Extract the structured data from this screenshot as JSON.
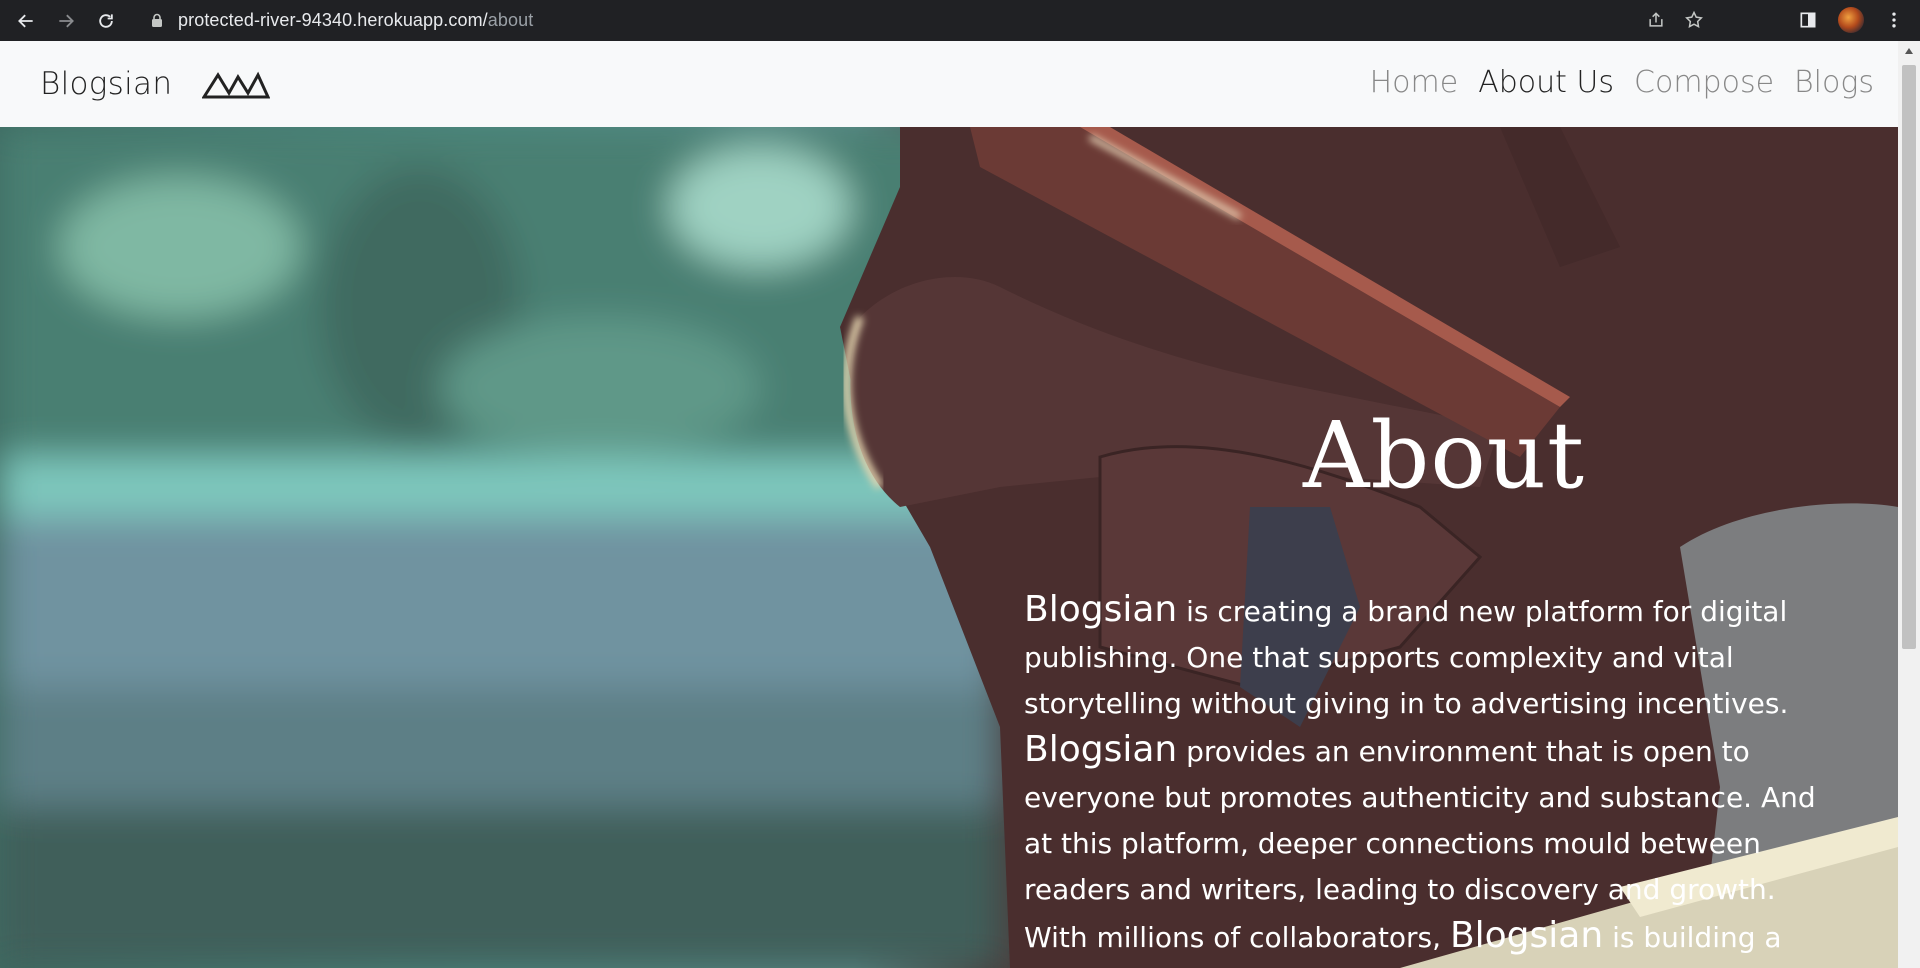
{
  "browser": {
    "url_host": "protected-river-94340.herokuapp.com/",
    "url_path": "about",
    "icons": [
      "back-icon",
      "forward-icon",
      "reload-icon",
      "lock-icon",
      "share-icon",
      "bookmark-star-icon",
      "side-panel-icon",
      "profile-avatar",
      "menu-dots-icon"
    ]
  },
  "navbar": {
    "brand": "Blogsian",
    "logo_icon": "mountains-icon",
    "links": [
      "Home",
      "About Us",
      "Compose",
      "Blogs"
    ],
    "active_link": "About Us"
  },
  "hero": {
    "title": "About",
    "brand_word": "Blogsian",
    "p1": " is creating a brand new platform for digital publishing. One that supports complexity and vital storytelling without giving in to advertising incentives.",
    "p2": " provides an environment that is open to everyone but promotes authenticity and substance. And at this platform, deeper connections mould between readers and writers, leading to discovery and growth. With millions of collaborators, ",
    "p3": " is building a trusted and vibrant"
  },
  "colors": {
    "navbar_bg": "#f8f9fa",
    "chrome_bg": "#202124",
    "hero_text": "#ffffff"
  }
}
